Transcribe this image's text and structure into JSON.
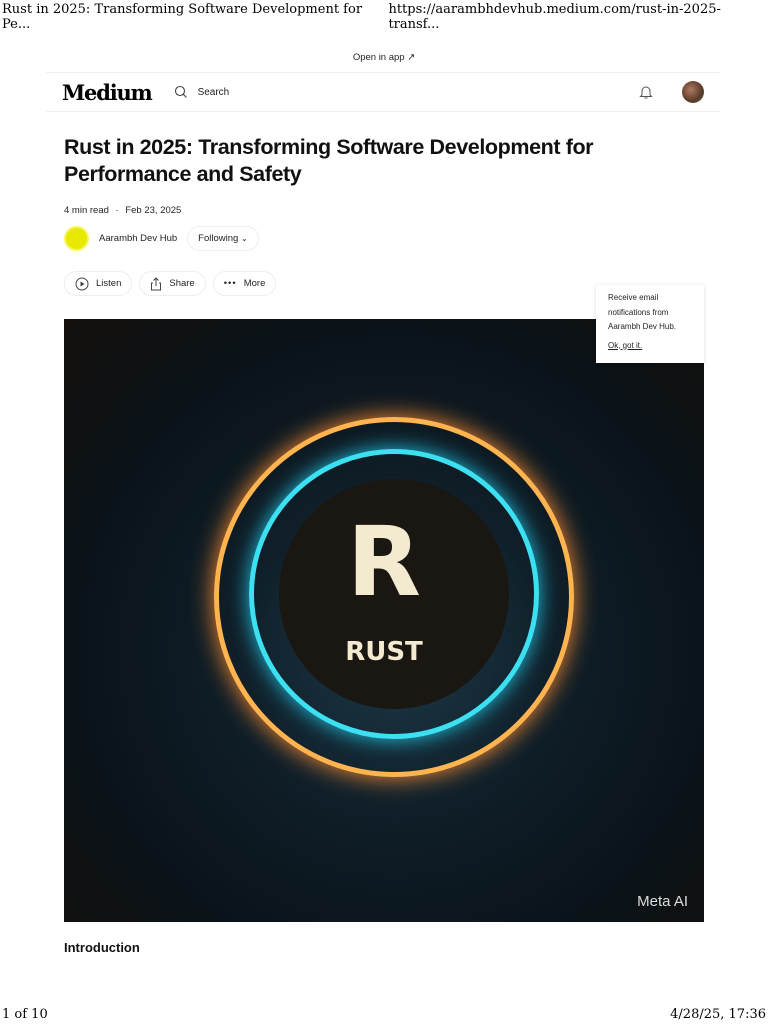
{
  "print": {
    "title": "Rust in 2025: Transforming Software Development for Pe...",
    "url": "https://aarambhdevhub.medium.com/rust-in-2025-transf...",
    "page": "1 of 10",
    "datetime": "4/28/25, 17:36"
  },
  "open_in_app": "Open in app ↗",
  "nav": {
    "logo": "Medium",
    "search": "Search"
  },
  "article": {
    "title": "Rust in 2025: Transforming Software Development for Performance and Safety",
    "read_time": "4 min read",
    "separator": "·",
    "date": "Feb 23, 2025",
    "author": "Aarambh Dev Hub",
    "follow": "Following",
    "follow_chevron": "⌄"
  },
  "actions": {
    "listen": "Listen",
    "share": "Share",
    "more": "More"
  },
  "hero": {
    "letter": "R",
    "word": "RUST",
    "watermark": "Meta AI"
  },
  "tooltip": {
    "text": "Receive email notifications from Aarambh Dev Hub.",
    "ok": "Ok, got it."
  },
  "section": {
    "heading": "Introduction"
  }
}
